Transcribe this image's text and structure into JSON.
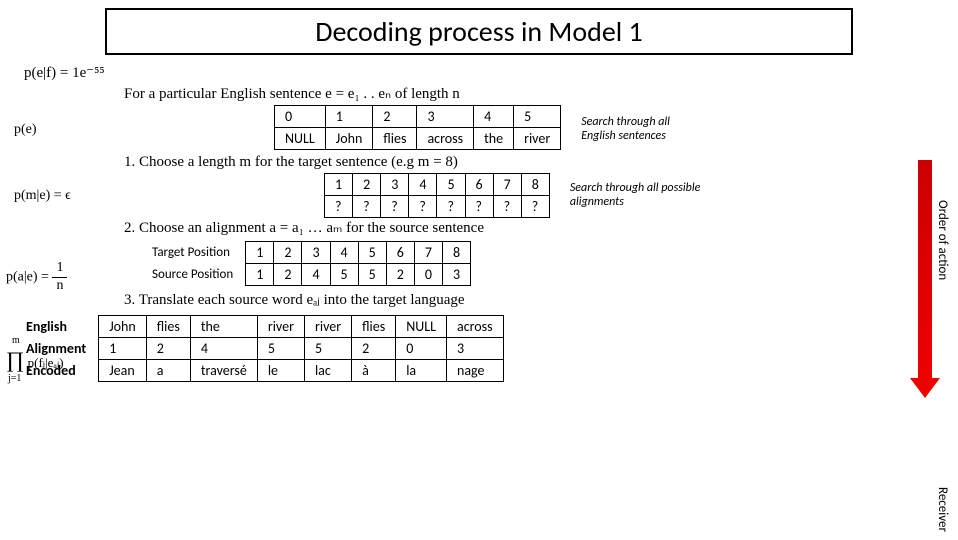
{
  "title": "Decoding process in Model 1",
  "formula1": {
    "lhs": "p(e|f) =",
    "rhs": "1e⁻⁵⁵"
  },
  "formula_sentence": "For a particular English sentence e = e₁ . . eₙ of length n",
  "formula2": "p(e)",
  "table1": {
    "row1": [
      "0",
      "1",
      "2",
      "3",
      "4",
      "5"
    ],
    "row2": [
      "NULL",
      "John",
      "flies",
      "across",
      "the",
      "river"
    ]
  },
  "caption1a": "Search through all",
  "caption1b": "English sentences",
  "step1": "1. Choose a length m for the target sentence (e.g m = 8)",
  "formula3": "p(m|e) = ϵ",
  "table2": {
    "row1": [
      "1",
      "2",
      "3",
      "4",
      "5",
      "6",
      "7",
      "8"
    ],
    "row2": [
      "?",
      "?",
      "?",
      "?",
      "?",
      "?",
      "?",
      "?"
    ]
  },
  "caption2a": "Search through all possible",
  "caption2b": "alignments",
  "step2": "2. Choose an alignment a = a₁ … aₘ for the source sentence",
  "formula4_lhs": "p(a|e) =",
  "formula4_rhs_top": "1",
  "formula4_rhs_bot": "n",
  "table3": {
    "label1": "Target Position",
    "label2": "Source Position",
    "tp": [
      "1",
      "2",
      "3",
      "4",
      "5",
      "6",
      "7",
      "8"
    ],
    "sp": [
      "1",
      "2",
      "4",
      "5",
      "5",
      "2",
      "0",
      "3"
    ]
  },
  "step3": "3. Translate each source word eₐⱼ into the target language",
  "formula5": "∏ p(fⱼ|eₐⱼ)",
  "formula5_sub": "j=1",
  "formula5_sup": "m",
  "table4": {
    "r1_label": "English",
    "r1": [
      "John",
      "flies",
      "the",
      "river",
      "river",
      "flies",
      "NULL",
      "across"
    ],
    "r2_label": "Alignment",
    "r2": [
      "1",
      "2",
      "4",
      "5",
      "5",
      "2",
      "0",
      "3"
    ],
    "r3_label": "Encoded",
    "r3": [
      "Jean",
      "a",
      "traversé",
      "le",
      "lac",
      "à",
      "la",
      "nage"
    ]
  },
  "side_label1": "Order of action",
  "side_label2": "Receiver"
}
